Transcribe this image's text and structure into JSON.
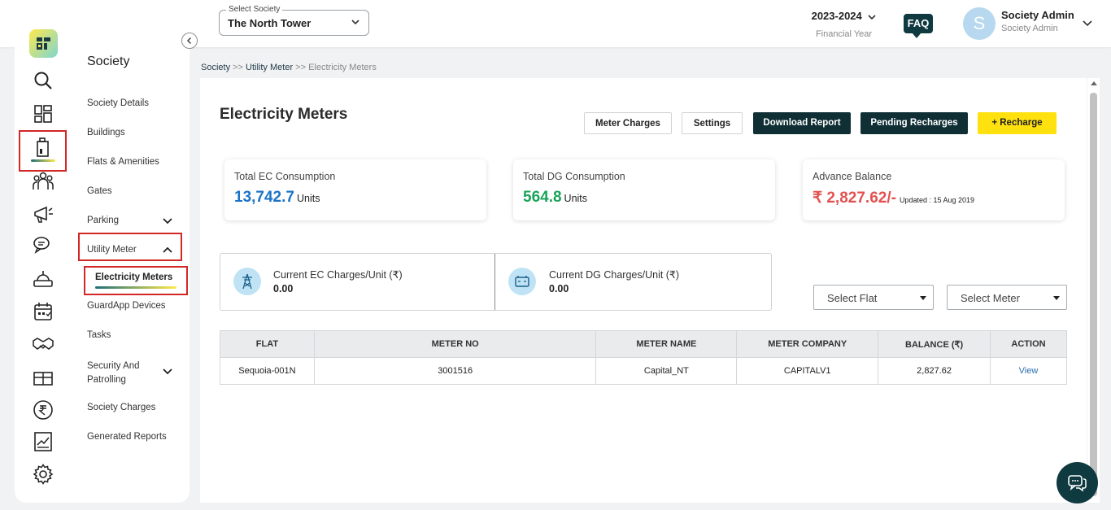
{
  "header": {
    "society_label": "Select Society",
    "society_value": "The North Tower",
    "financial_year": "2023-2024",
    "financial_year_label": "Financial Year",
    "faq_label": "FAQ",
    "avatar_letter": "S",
    "user_name": "Society Admin",
    "user_role": "Society Admin"
  },
  "rail": {
    "icons": [
      "app-logo-icon",
      "search-icon",
      "dashboard-icon",
      "society-building-icon",
      "members-icon",
      "announcement-icon",
      "chat-icon",
      "helpdesk-icon",
      "calendar-icon",
      "handshake-icon",
      "gift-icon",
      "rupee-icon",
      "report-chart-icon",
      "settings-gear-icon"
    ]
  },
  "sidebar": {
    "title": "Society",
    "items": [
      "Society Details",
      "Buildings",
      "Flats & Amenities",
      "Gates",
      "Parking",
      "Utility Meter",
      "Electricity Meters",
      "GuardApp Devices",
      "Tasks",
      "Security And Patrolling",
      "Society Charges",
      "Generated Reports"
    ]
  },
  "breadcrumb": {
    "part1": "Society",
    "sep": " >> ",
    "part2": "Utility Meter",
    "part3": "Electricity Meters"
  },
  "main": {
    "title": "Electricity Meters",
    "buttons": {
      "meter_charges": "Meter Charges",
      "settings": "Settings",
      "download_report": "Download Report",
      "pending_recharges": "Pending Recharges",
      "recharge": "+ Recharge"
    },
    "cards": {
      "ec_label": "Total EC Consumption",
      "ec_value": "13,742.7",
      "ec_unit": "Units",
      "dg_label": "Total DG Consumption",
      "dg_value": "564.8",
      "dg_unit": "Units",
      "balance_label": "Advance Balance",
      "balance_value": "₹ 2,827.62/-",
      "balance_updated": "Updated : 15 Aug 2019"
    },
    "charges": {
      "ec_label": "Current EC Charges/Unit (₹)",
      "ec_value": "0.00",
      "dg_label": "Current DG Charges/Unit (₹)",
      "dg_value": "0.00"
    },
    "filters": {
      "flat_placeholder": "Select Flat",
      "meter_placeholder": "Select Meter"
    },
    "table": {
      "columns": [
        "FLAT",
        "METER NO",
        "METER NAME",
        "METER COMPANY",
        "BALANCE (₹)",
        "ACTION"
      ],
      "rows": [
        [
          "Sequoia-001N",
          "3001516",
          "Capital_NT",
          "CAPITALV1",
          "2,827.62",
          "View"
        ]
      ]
    }
  },
  "colors": {
    "brand_dark": "#0f2f35",
    "accent_yellow": "#ffe110",
    "ec_blue": "#1a73c7",
    "dg_green": "#1aa35a",
    "balance_red": "#e45050",
    "highlight_red": "#d32626"
  }
}
